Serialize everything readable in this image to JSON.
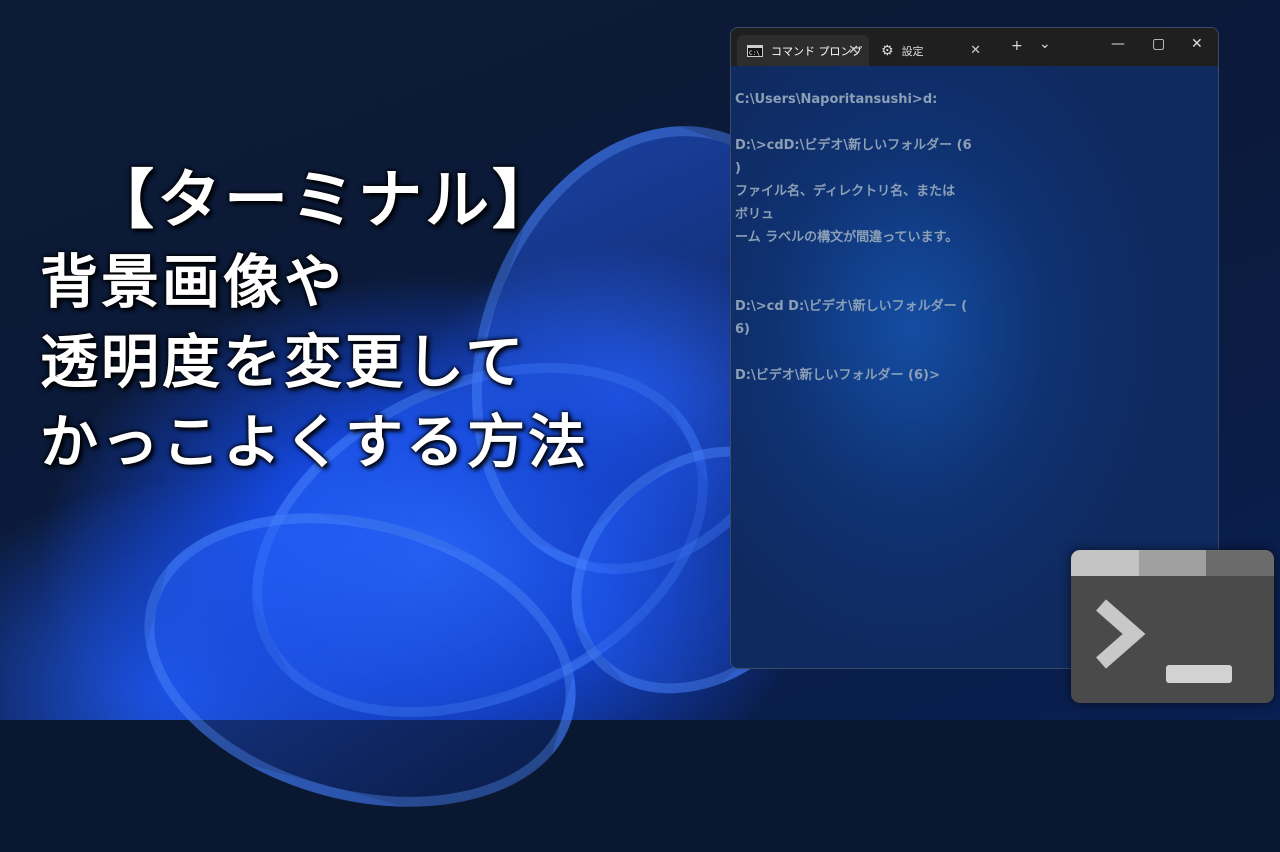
{
  "headline": {
    "line1": "【ターミナル】",
    "line2": "背景画像や",
    "line3": "透明度を変更して",
    "line4": "かっこよくする方法"
  },
  "terminal": {
    "tabs": [
      {
        "label": "コマンド プロンプ",
        "icon": "cmd-icon",
        "active": true
      },
      {
        "label": "設定",
        "icon": "gear-icon",
        "active": false
      }
    ],
    "new_tab": "+",
    "dropdown": "⌄",
    "window_controls": {
      "minimize": "—",
      "maximize": "▢",
      "close": "✕"
    },
    "output": "C:\\Users\\Naporitansushi>d:\n\nD:\\>cdD:\\ビデオ\\新しいフォルダー (6\n)\nファイル名、ディレクトリ名、または\nボリュ\nーム ラベルの構文が間違っています。\n\n\nD:\\>cd D:\\ビデオ\\新しいフォルダー (\n6)\n\nD:\\ビデオ\\新しいフォルダー (6)>"
  },
  "colors": {
    "accent": "#1e5cff",
    "terminal_text": "#8b9fb6",
    "tabbar": "#1f1f1f"
  },
  "app_icon": {
    "name": "windows-terminal-icon"
  }
}
